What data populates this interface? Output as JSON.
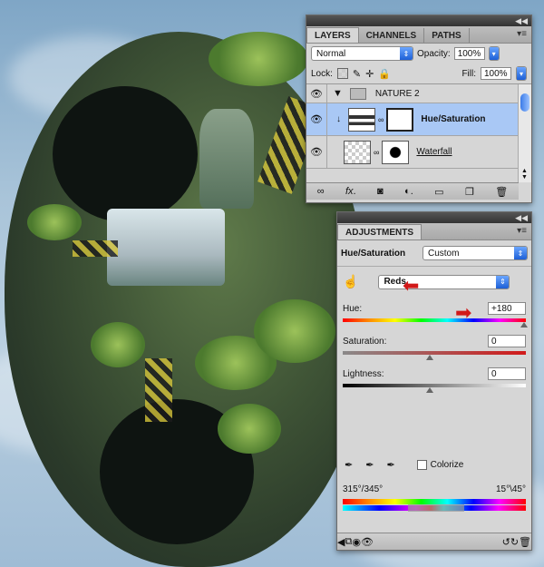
{
  "layers_panel": {
    "tabs": [
      "LAYERS",
      "CHANNELS",
      "PATHS"
    ],
    "blend_mode": "Normal",
    "opacity_label": "Opacity:",
    "opacity_value": "100%",
    "lock_label": "Lock:",
    "fill_label": "Fill:",
    "fill_value": "100%",
    "group_name": "NATURE 2",
    "layers": [
      {
        "name": "Hue/Saturation",
        "selected": true
      },
      {
        "name": "Waterfall",
        "selected": false
      }
    ]
  },
  "adjustments_panel": {
    "tab": "ADJUSTMENTS",
    "adjustment_name": "Hue/Saturation",
    "preset": "Custom",
    "channel": "Reds",
    "hue_label": "Hue:",
    "hue_value": "+180",
    "saturation_label": "Saturation:",
    "saturation_value": "0",
    "lightness_label": "Lightness:",
    "lightness_value": "0",
    "colorize_label": "Colorize",
    "range_left": "315°/345°",
    "range_right": "15°\\45°"
  },
  "colors": {
    "accent_red": "#d11919",
    "selected_row": "#a9c8f5",
    "select_blue": "#1d5fd6"
  }
}
